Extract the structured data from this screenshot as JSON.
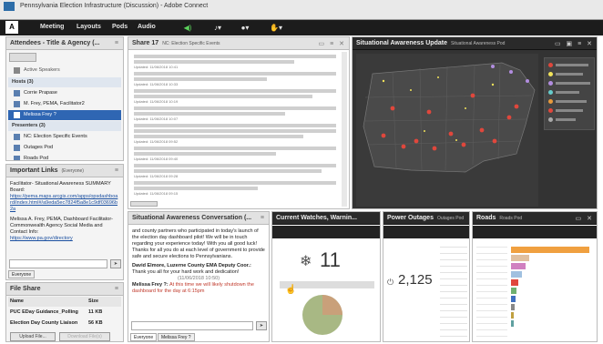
{
  "window": {
    "title": "Pennsylvania Election Infrastructure (Discussion) - Adobe Connect"
  },
  "menubar": {
    "items": [
      "Meeting",
      "Layouts",
      "Pods",
      "Audio"
    ]
  },
  "attendees": {
    "title": "Attendees - Title & Agency (...",
    "active_speakers_label": "Active Speakers",
    "hosts_label": "Hosts (3)",
    "hosts": [
      "Corrie Prapase",
      "M. Frey, PEMA, Facilitator2",
      "Melissa Frey ?"
    ],
    "presenters_label": "Presenters (3)",
    "presenters": [
      "NC: Election Specific Events",
      "Outages Pod",
      "Roads Pod"
    ],
    "participants_label": "Participants (25)"
  },
  "links": {
    "title": "Important Links",
    "title_sub": "(Everyone)",
    "p1_label": "Facilitator- Situational Awareness SUMMARY Board:",
    "p1_url": "https://pema.maps.arcgis.com/apps/opsdashboard/index.html#/a9eda5ec7824f5a8e1c9df03696b2a",
    "p2_label": "Melissa A. Frey, PEMA, Dashboard Facilitator- Commonwealth Agency Social Media and Contact Info:",
    "p2_url": "https://www.pa.gov/directory",
    "tab": "Everyone"
  },
  "fileshare": {
    "title": "File Share",
    "col_name": "Name",
    "col_size": "Size",
    "files": [
      {
        "name": "PUC EDay Guidance_Polling",
        "size": "11 KB"
      },
      {
        "name": "Election Day County Liaison",
        "size": "56 KB"
      }
    ],
    "upload_label": "Upload File...",
    "download_label": "Download File(s)"
  },
  "share": {
    "title": "Share 17",
    "sub": "NC: Election Specific Events",
    "timestamps": [
      "Updated: 11/06/2018 10:41",
      "Updated: 11/06/2018 10:33",
      "Updated: 11/06/2018 10:19",
      "Updated: 11/06/2018 10:07",
      "Updated: 11/06/2018 09:52",
      "Updated: 11/06/2018 09:40",
      "Updated: 11/06/2018 09:28",
      "Updated: 11/06/2018 09:15"
    ]
  },
  "map": {
    "title": "Situational Awareness Update",
    "sub": "Situational Awareness Pod"
  },
  "conversation": {
    "title": "Situational Awareness Conversation",
    "title_suffix": "(...",
    "message": "and county partners who participated in today's launch of the election day dashboard pilot! We will be in touch regarding your experience today! With you all good luck! Thanks for all you do at each level of government to provide safe and secure elections to Pennsylvanians.",
    "author2": "David Elmore, Luzerne County EMA Deputy Coor.:",
    "message2": "Thank you all for your hard work and dedication!",
    "timestamp": "(11/06/2018 10:50)",
    "author3": "Melissa Frey ?:",
    "message3": "At this time we will likely shutdown the dashboard for the day at 6:15pm",
    "tabs": [
      "Everyone",
      "Melissa Frey ?"
    ]
  },
  "watches": {
    "title": "Current Watches, Warnin...",
    "value": "11"
  },
  "outages": {
    "title": "Power Outages",
    "sub": "Outages Pod",
    "value": "2,125"
  },
  "roads": {
    "title": "Roads",
    "sub": "Roads Pod"
  },
  "colors": {
    "menubar": "#1c1c1c",
    "selected": "#2f66b3",
    "accent_red": "#e0473c",
    "pie_green": "#a8b884",
    "pie_tan": "#c9a07a"
  }
}
